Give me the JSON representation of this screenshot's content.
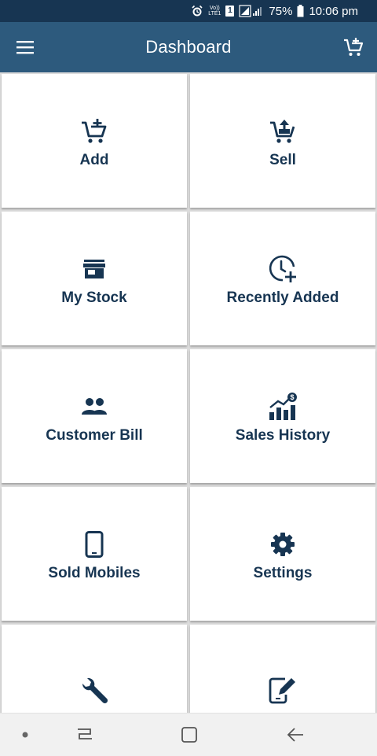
{
  "status_bar": {
    "volte_label": "Vo))",
    "lte_label": "LTE1",
    "sim_label": "1",
    "battery": "75%",
    "time": "10:06 pm",
    "icons": [
      "alarm-icon",
      "volte-icon",
      "sim-icon",
      "signal-icon",
      "battery-icon"
    ]
  },
  "app_bar": {
    "title": "Dashboard",
    "left_icon": "menu-icon",
    "right_icon": "cart-add-icon"
  },
  "tiles": [
    {
      "label": "Add",
      "icon": "cart-add-icon"
    },
    {
      "label": "Sell",
      "icon": "cart-sell-icon"
    },
    {
      "label": "My Stock",
      "icon": "store-icon"
    },
    {
      "label": "Recently Added",
      "icon": "clock-add-icon"
    },
    {
      "label": "Customer Bill",
      "icon": "people-icon"
    },
    {
      "label": "Sales History",
      "icon": "sales-chart-icon"
    },
    {
      "label": "Sold Mobiles",
      "icon": "mobile-icon"
    },
    {
      "label": "Settings",
      "icon": "gear-icon"
    },
    {
      "label": "",
      "icon": "wrench-icon"
    },
    {
      "label": "",
      "icon": "mobile-edit-icon"
    }
  ],
  "nav_bar": {
    "icons": [
      "dot-icon",
      "recents-icon",
      "home-icon",
      "back-icon"
    ]
  },
  "colors": {
    "status_bar": "#173552",
    "app_bar": "#2d5a7d",
    "accent_text": "#173552",
    "grid_gap": "#dcdcdc"
  }
}
